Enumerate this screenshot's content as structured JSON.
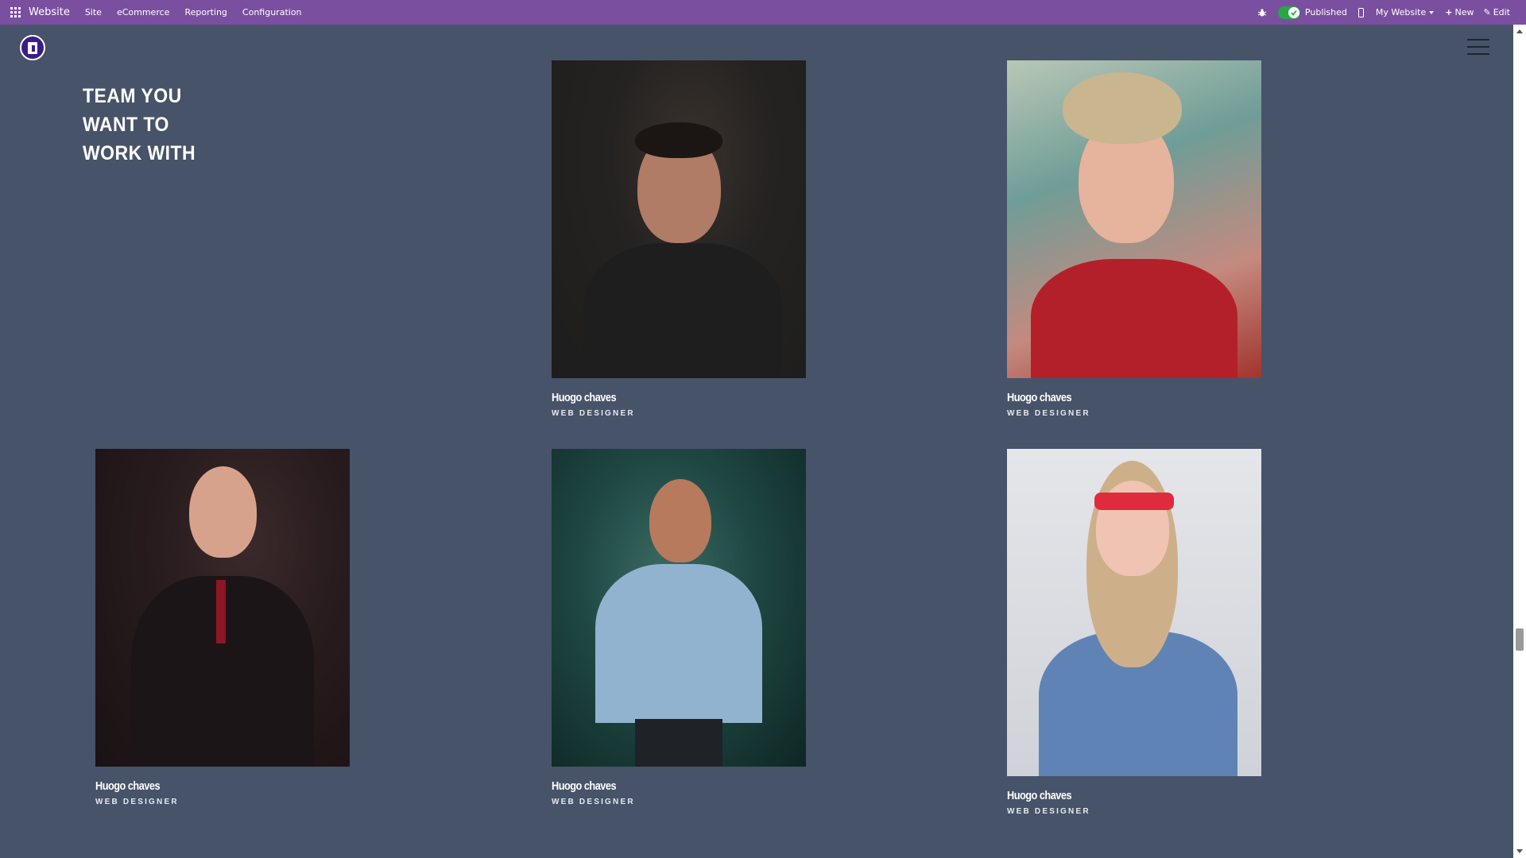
{
  "topbar": {
    "brand": "Website",
    "menu": [
      "Site",
      "eCommerce",
      "Reporting",
      "Configuration"
    ],
    "published_label": "Published",
    "site_selector": "My Website",
    "new_label": "New",
    "edit_label": "Edit",
    "accent_color": "#7a4fa0"
  },
  "section": {
    "heading_lines": [
      "TEAM YOU",
      "WANT TO",
      "WORK WITH"
    ]
  },
  "members": [
    {
      "name": "Huogo chaves",
      "role": "WEB DESIGNER"
    },
    {
      "name": "Huogo chaves",
      "role": "WEB DESIGNER"
    },
    {
      "name": "Huogo chaves",
      "role": "WEB DESIGNER"
    },
    {
      "name": "Huogo chaves",
      "role": "WEB DESIGNER"
    },
    {
      "name": "Huogo chaves",
      "role": "WEB DESIGNER"
    }
  ],
  "icons": {
    "apps": "apps-grid-icon",
    "debug": "bug-icon",
    "mobile": "mobile-preview-icon",
    "logo": "site-logo",
    "menu": "hamburger-menu-icon"
  }
}
